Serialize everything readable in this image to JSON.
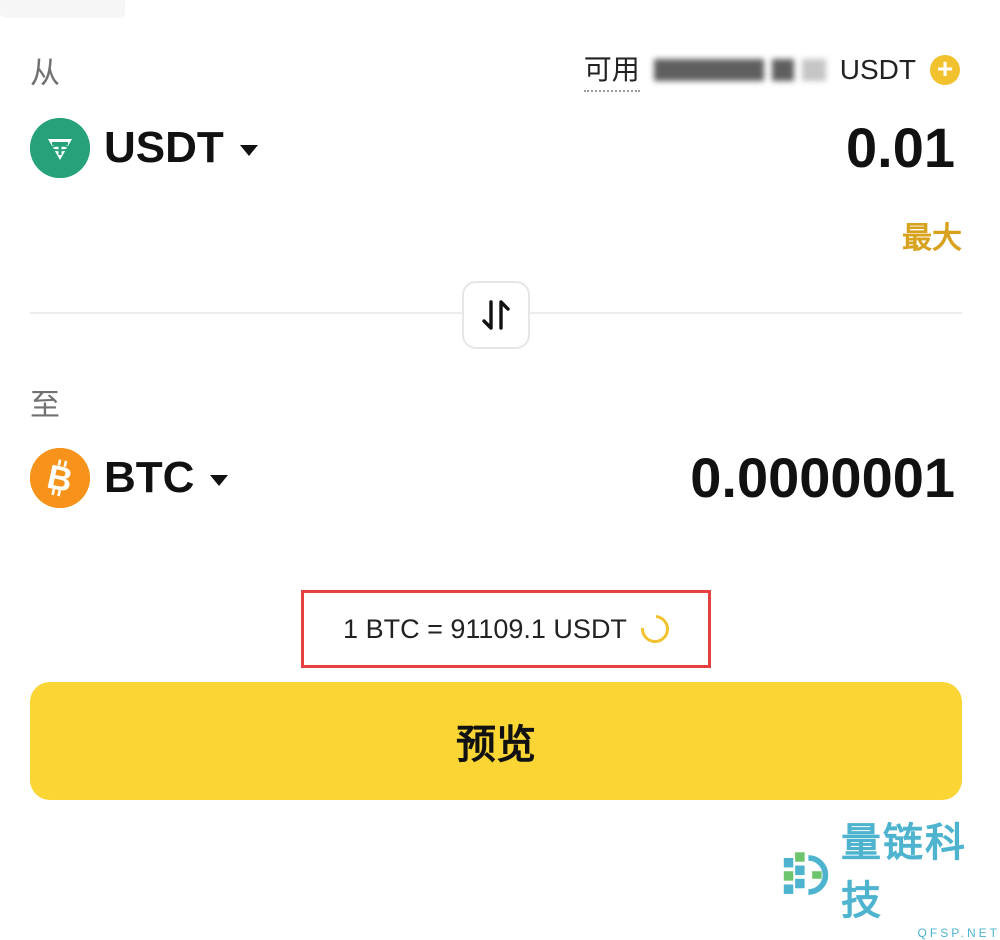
{
  "from": {
    "section_label": "从",
    "available_label": "可用",
    "available_currency": "USDT",
    "coin": {
      "symbol": "USDT",
      "color": "#26a17b",
      "icon": "tether-icon"
    },
    "amount": "0.01",
    "max_label": "最大"
  },
  "to": {
    "section_label": "至",
    "coin": {
      "symbol": "BTC",
      "color": "#f7931a",
      "icon": "bitcoin-icon"
    },
    "amount": "0.0000001"
  },
  "rate": {
    "text": "1 BTC = 91109.1 USDT"
  },
  "preview_button": {
    "label": "预览",
    "color": "#fad534"
  },
  "watermark": {
    "title": "量链科技",
    "subtitle": "QFSP.NET"
  },
  "colors": {
    "accent": "#f2c12e",
    "highlight_box": "#e64040"
  }
}
